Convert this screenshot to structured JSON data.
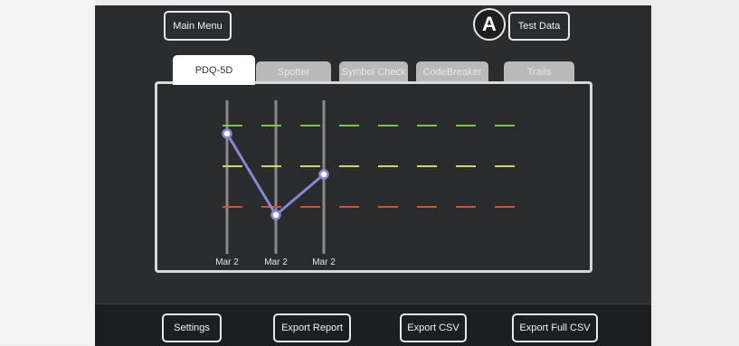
{
  "header": {
    "main_menu_label": "Main Menu",
    "test_data_label": "Test Data",
    "badge_letter": "A"
  },
  "tabs": [
    {
      "label": "PDQ-5D",
      "active": true
    },
    {
      "label": "Spotter",
      "active": false
    },
    {
      "label": "Symbol Check",
      "active": false
    },
    {
      "label": "CodeBreaker",
      "active": false
    },
    {
      "label": "Trails",
      "active": false
    }
  ],
  "chart_data": {
    "type": "line",
    "categories": [
      "Mar 2",
      "Mar 2",
      "Mar 2"
    ],
    "series": [
      {
        "values": [
          3,
          1,
          2
        ]
      }
    ],
    "ylim": [
      0,
      4
    ],
    "reference_levels": [
      {
        "value": 3.2,
        "color": "#7ec24c"
      },
      {
        "value": 2.2,
        "color": "#d6d64a"
      },
      {
        "value": 1.2,
        "color": "#c4573c"
      }
    ],
    "line_color": "#8a86d6",
    "grid": false
  },
  "footer": {
    "settings_label": "Settings",
    "export_report_label": "Export Report",
    "export_csv_label": "Export CSV",
    "export_full_csv_label": "Export Full CSV"
  }
}
